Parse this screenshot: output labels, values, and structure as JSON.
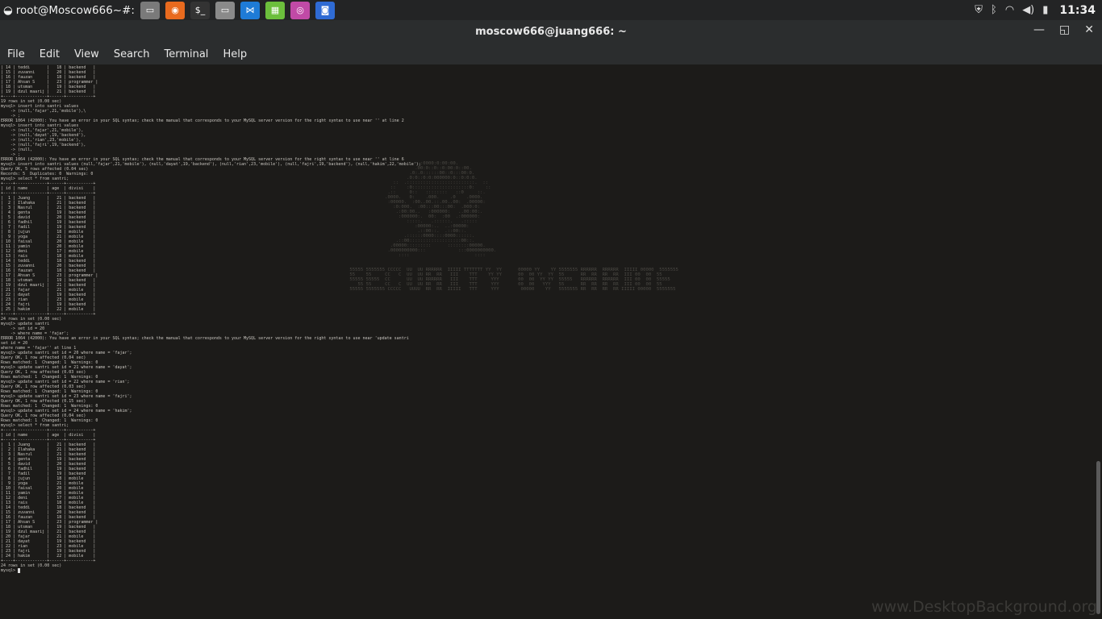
{
  "panel": {
    "workspace_title": "root@Moscow666~#:",
    "launchers": [
      {
        "name": "files-launcher",
        "glyph": "▭",
        "color": "#7a7a7a"
      },
      {
        "name": "firefox-launcher",
        "glyph": "◉",
        "color": "#e86a1e"
      },
      {
        "name": "terminal-launcher",
        "glyph": "$_",
        "color": "#333333"
      },
      {
        "name": "folder-launcher",
        "glyph": "▭",
        "color": "#8a8a8a"
      },
      {
        "name": "vscode-launcher",
        "glyph": "⋈",
        "color": "#1e7bd6"
      },
      {
        "name": "calc-launcher",
        "glyph": "▦",
        "color": "#6cbf3c"
      },
      {
        "name": "camera-launcher",
        "glyph": "◎",
        "color": "#c04aa6"
      },
      {
        "name": "screenshot-launcher",
        "glyph": "◙",
        "color": "#2f6bd4"
      }
    ],
    "clock": "11:34"
  },
  "window": {
    "title": "moscow666@juang666: ~",
    "minimize": "—",
    "maximize": "◱",
    "close": "✕"
  },
  "menu": [
    "File",
    "Edit",
    "View",
    "Search",
    "Terminal",
    "Help"
  ],
  "terminal": {
    "lines": [
      "| 14 | teddi       |   18 | backend   |",
      "| 15 | zuvanni     |   20 | backend   |",
      "| 16 | fauzan      |   18 | backend   |",
      "| 17 | Ahsan S     |   23 | programmer |",
      "| 18 | utsman      |   19 | backend   |",
      "| 19 | dzul maarij |   21 | backend   |",
      "+----+-------------+------+-----------+",
      "19 rows in set (0.00 sec)",
      "",
      "mysql> insert into santri values",
      "    -> (null,'fajar',21,'mobile'),\\",
      "    -> ;",
      "ERROR 1064 (42000): You have an error in your SQL syntax; check the manual that corresponds to your MySQL server version for the right syntax to use near '' at line 2",
      "mysql> insert into santri values",
      "    -> (null,'fajar',21,'mobile'),",
      "    -> (null,'dayat',19,'backend'),",
      "    -> (null,'rian',23,'mobile'),",
      "    -> (null,'fajri',19,'backend'),",
      "    -> (null,",
      "    -> ;",
      "ERROR 1064 (42000): You have an error in your SQL syntax; check the manual that corresponds to your MySQL server version for the right syntax to use near '' at line 6",
      "mysql> insert into santri values (null,'fajar',21,'mobile'), (null,'dayat',19,'backend'), (null,'rian',23,'mobile'), (null,'fajri',19,'backend'), (null,'hakim',22,'mobile');",
      "Query OK, 5 rows affected (0.04 sec)",
      "Records: 5  Duplicates: 0  Warnings: 0",
      "",
      "mysql> select * from santri;",
      "+----+-------------+------+-----------+",
      "| id | name        | age  | divisi    |",
      "+----+-------------+------+-----------+",
      "|  1 | Juang       |   21 | backend   |",
      "|  2 | Ilahaka     |   21 | backend   |",
      "|  3 | Nasrul      |   21 | backend   |",
      "|  4 | genta       |   19 | backend   |",
      "|  5 | david       |   20 | backend   |",
      "|  6 | fadhil      |   19 | backend   |",
      "|  7 | fadil       |   19 | backend   |",
      "|  8 | jujun       |   18 | mobile    |",
      "|  9 | yoga        |   21 | mobile    |",
      "| 10 | faisal      |   20 | mobile    |",
      "| 11 | yamin       |   20 | mobile    |",
      "| 12 | deni        |   17 | mobile    |",
      "| 13 | rais        |   18 | mobile    |",
      "| 14 | teddi       |   18 | backend   |",
      "| 15 | zuvanni     |   20 | backend   |",
      "| 16 | fauzan      |   18 | backend   |",
      "| 17 | Ahsan S     |   23 | programmer |",
      "| 18 | utsman      |   19 | backend   |",
      "| 19 | dzul maarij |   21 | backend   |",
      "| 21 | fajar       |   21 | mobile    |",
      "| 22 | dayat       |   19 | backend   |",
      "| 23 | rian        |   23 | mobile    |",
      "| 24 | fajri       |   19 | backend   |",
      "| 25 | hakim       |   22 | mobile    |",
      "+----+-------------+------+-----------+",
      "24 rows in set (0.00 sec)",
      "",
      "mysql> update santri",
      "    -> set id = 20",
      "    -> where name = 'fajar';",
      "ERROR 1064 (42000): You have an error in your SQL syntax; check the manual that corresponds to your MySQL server version for the right syntax to use near 'update santri",
      "set id = 20",
      "where name = 'fajar'' at line 1",
      "mysql> update santri set id = 20 where name = 'fajar';",
      "Query OK, 1 row affected (0.04 sec)",
      "Rows matched: 1  Changed: 1  Warnings: 0",
      "",
      "mysql> update santri set id = 21 where name = 'dayat';",
      "Query OK, 1 row affected (0.03 sec)",
      "Rows matched: 1  Changed: 1  Warnings: 0",
      "",
      "mysql> update santri set id = 22 where name = 'rian';",
      "Query OK, 1 row affected (0.03 sec)",
      "Rows matched: 1  Changed: 1  Warnings: 0",
      "",
      "mysql> update santri set id = 23 where name = 'fajri';",
      "Query OK, 1 row affected (0.15 sec)",
      "Rows matched: 1  Changed: 1  Warnings: 0",
      "",
      "mysql> update santri set id = 24 where name = 'hakim';",
      "Query OK, 1 row affected (0.04 sec)",
      "Rows matched: 1  Changed: 1  Warnings: 0",
      "",
      "mysql> select * from santri;",
      "+----+-------------+------+-----------+",
      "| id | name        | age  | divisi    |",
      "+----+-------------+------+-----------+",
      "|  1 | Juang       |   21 | backend   |",
      "|  2 | Ilahaka     |   21 | backend   |",
      "|  3 | Nasrul      |   21 | backend   |",
      "|  4 | genta       |   19 | backend   |",
      "|  5 | david       |   20 | backend   |",
      "|  6 | fadhil      |   19 | backend   |",
      "|  7 | fadil       |   19 | backend   |",
      "|  8 | jujun       |   18 | mobile    |",
      "|  9 | yoga        |   21 | mobile    |",
      "| 10 | faisal      |   20 | mobile    |",
      "| 11 | yamin       |   20 | mobile    |",
      "| 12 | deni        |   17 | mobile    |",
      "| 13 | rais        |   18 | mobile    |",
      "| 14 | teddi       |   18 | backend   |",
      "| 15 | zuvanni     |   20 | backend   |",
      "| 16 | fauzan      |   18 | backend   |",
      "| 17 | Ahsan S     |   23 | programmer |",
      "| 18 | utsman      |   19 | backend   |",
      "| 19 | dzul maarij |   21 | backend   |",
      "| 20 | fajar       |   21 | mobile    |",
      "| 21 | dayat       |   19 | backend   |",
      "| 22 | rian        |   23 | mobile    |",
      "| 23 | fajri       |   19 | backend   |",
      "| 24 | hakim       |   22 | mobile    |",
      "+----+-------------+------+-----------+",
      "24 rows in set (0.00 sec)",
      "",
      "mysql> "
    ]
  },
  "watermark": "www.DesktopBackground.org"
}
